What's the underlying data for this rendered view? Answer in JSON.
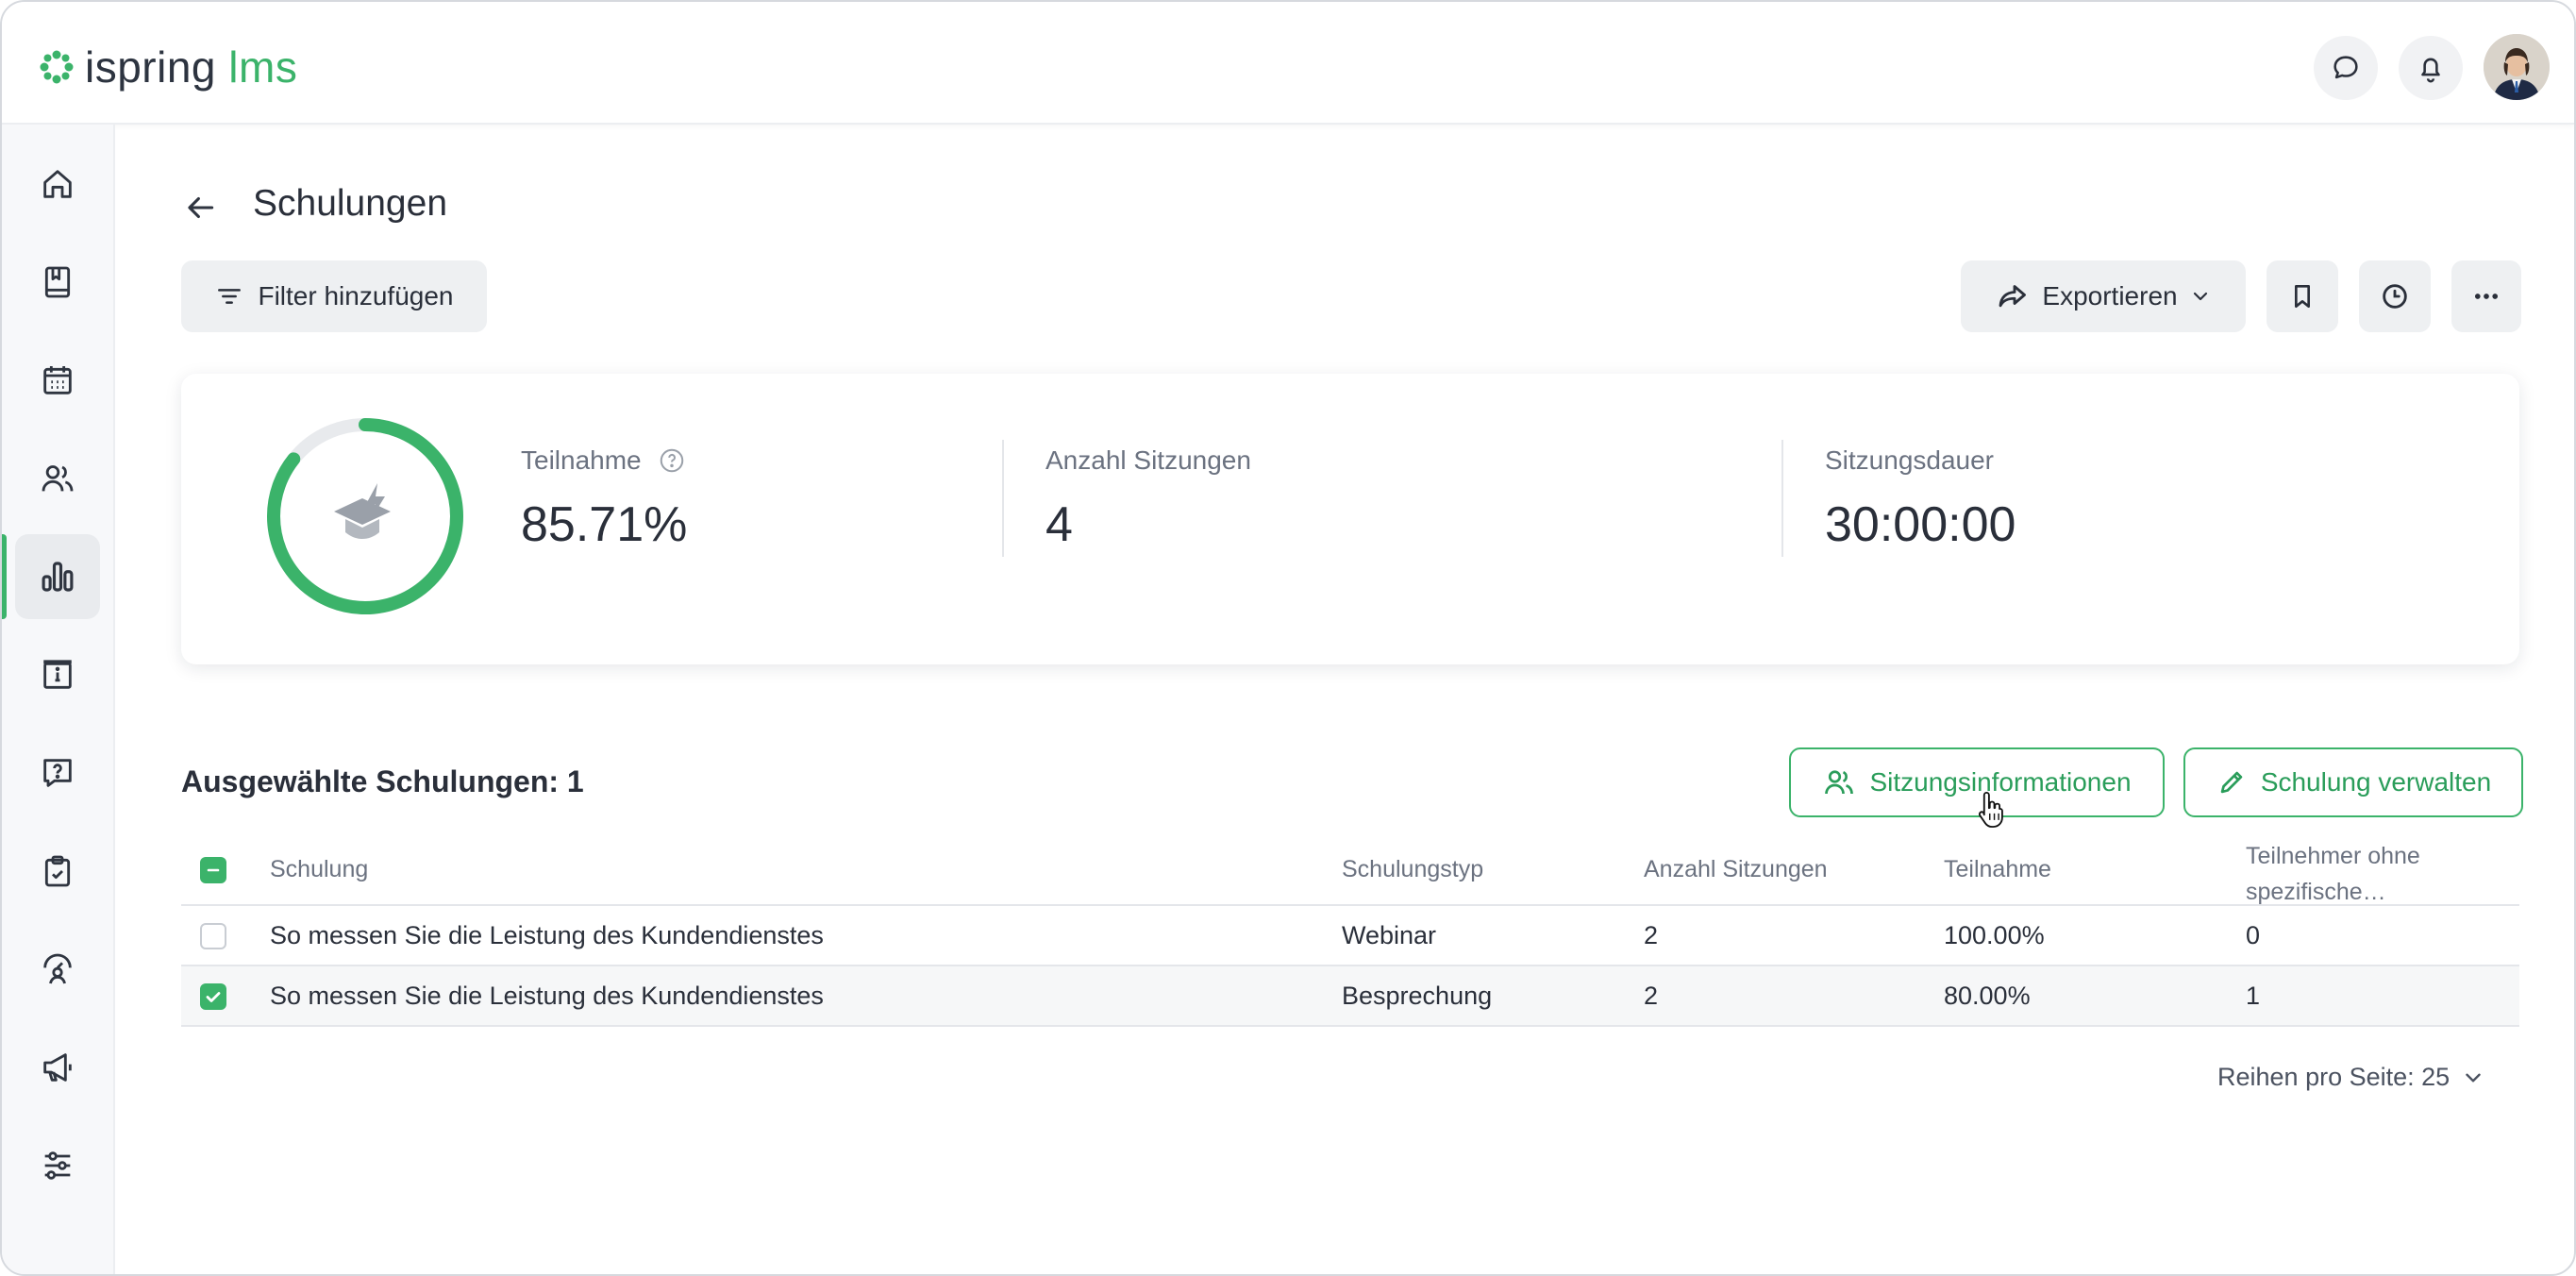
{
  "brand": {
    "logo_text": "ispring",
    "logo_suffix": "lms",
    "accent": "#3bb36a"
  },
  "header": {
    "icons": [
      "chat-icon",
      "bell-icon",
      "avatar"
    ]
  },
  "sidebar": {
    "items": [
      {
        "name": "home-icon"
      },
      {
        "name": "book-icon"
      },
      {
        "name": "calendar-icon"
      },
      {
        "name": "users-icon"
      },
      {
        "name": "reports-icon",
        "active": true
      },
      {
        "name": "info-board-icon"
      },
      {
        "name": "question-icon"
      },
      {
        "name": "clipboard-check-icon"
      },
      {
        "name": "person-gauge-icon"
      },
      {
        "name": "megaphone-icon"
      },
      {
        "name": "sliders-icon"
      }
    ]
  },
  "page": {
    "title": "Schulungen",
    "filter_button": "Filter hinzufügen",
    "export_button": "Exportieren"
  },
  "summary": {
    "participation_label": "Teilnahme",
    "participation_value": "85.71%",
    "participation_fraction": 0.8571,
    "sessions_label": "Anzahl Sitzungen",
    "sessions_value": "4",
    "duration_label": "Sitzungsdauer",
    "duration_value": "30:00:00"
  },
  "selection": {
    "label": "Ausgewählte Schulungen: 1",
    "session_info_button": "Sitzungsinformationen",
    "manage_button": "Schulung verwalten"
  },
  "table": {
    "headers": [
      "Schulung",
      "Schulungstyp",
      "Anzahl Sitzungen",
      "Teilnahme",
      "Teilnehmer ohne",
      "spezifische…"
    ],
    "rows": [
      {
        "name": "So messen Sie die Leistung des Kundendienstes",
        "type": "Webinar",
        "sessions": "2",
        "participation": "100.00%",
        "without": "0",
        "checked": false
      },
      {
        "name": "So messen Sie die Leistung des Kundendienstes",
        "type": "Besprechung",
        "sessions": "2",
        "participation": "80.00%",
        "without": "1",
        "checked": true
      }
    ]
  },
  "pagination": {
    "rows_per_page": "Reihen pro Seite: 25"
  }
}
